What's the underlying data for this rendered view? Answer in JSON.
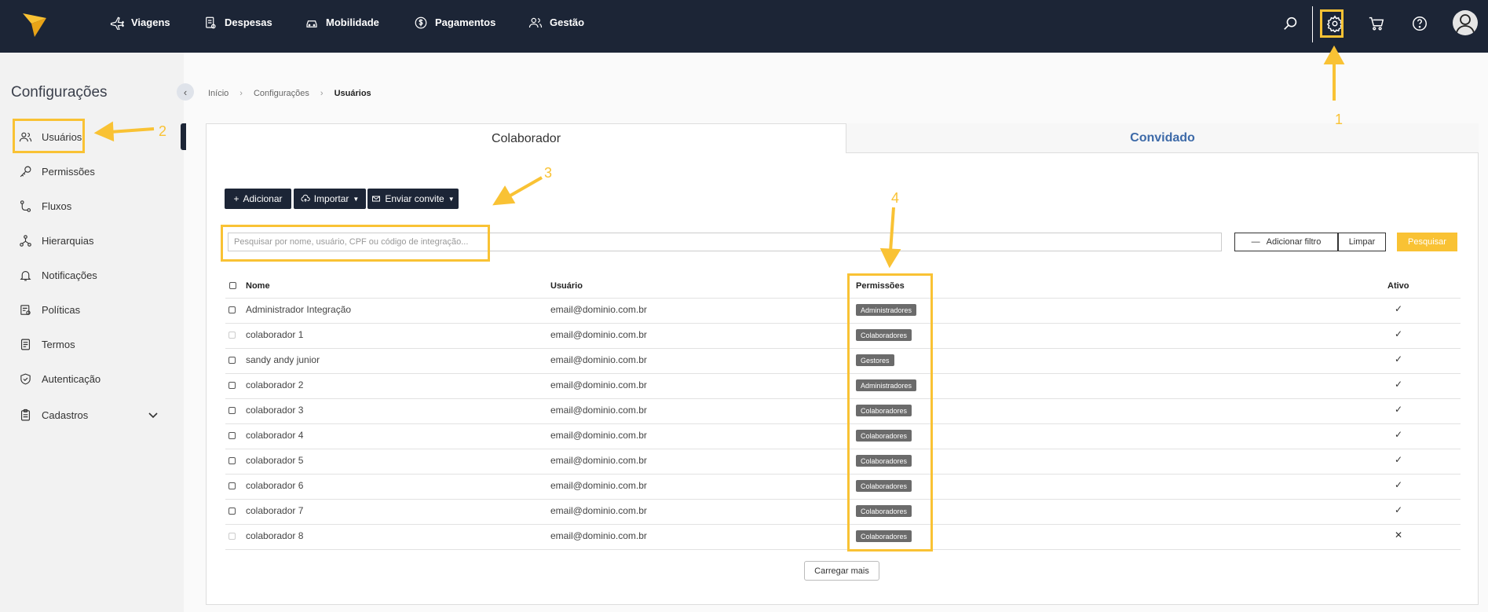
{
  "nav": {
    "items": [
      {
        "label": "Viagens",
        "icon": "plane-icon"
      },
      {
        "label": "Despesas",
        "icon": "receipt-icon"
      },
      {
        "label": "Mobilidade",
        "icon": "car-icon"
      },
      {
        "label": "Pagamentos",
        "icon": "dollar-icon"
      },
      {
        "label": "Gestão",
        "icon": "users-icon"
      }
    ],
    "right_icons": [
      "search-icon",
      "gear-icon",
      "cart-icon",
      "help-icon",
      "avatar-icon"
    ]
  },
  "sidebar": {
    "title": "Configurações",
    "items": [
      {
        "label": "Usuários",
        "icon": "users-icon"
      },
      {
        "label": "Permissões",
        "icon": "key-icon"
      },
      {
        "label": "Fluxos",
        "icon": "flow-icon"
      },
      {
        "label": "Hierarquias",
        "icon": "hierarchy-icon"
      },
      {
        "label": "Notificações",
        "icon": "bell-icon"
      },
      {
        "label": "Políticas",
        "icon": "policy-icon"
      },
      {
        "label": "Termos",
        "icon": "document-icon"
      },
      {
        "label": "Autenticação",
        "icon": "shield-icon"
      },
      {
        "label": "Cadastros",
        "icon": "clipboard-icon"
      }
    ]
  },
  "breadcrumb": [
    "Início",
    "Configurações",
    "Usuários"
  ],
  "tabs": {
    "collaborator": "Colaborador",
    "guest": "Convidado"
  },
  "toolbar": {
    "add": "Adicionar",
    "import": "Importar",
    "invite": "Enviar convite"
  },
  "search": {
    "placeholder": "Pesquisar por nome, usuário, CPF ou código de integração...",
    "add_filter": "Adicionar filtro",
    "clear": "Limpar",
    "search": "Pesquisar"
  },
  "table": {
    "headers": {
      "name": "Nome",
      "user": "Usuário",
      "permissions": "Permissões",
      "active": "Ativo"
    },
    "rows": [
      {
        "name": "Administrador Integração",
        "user": "email@dominio.com.br",
        "permission": "Administradores",
        "active": "✓"
      },
      {
        "name": "colaborador 1",
        "user": "email@dominio.com.br",
        "permission": "Colaboradores",
        "active": "✓"
      },
      {
        "name": "sandy andy junior",
        "user": "email@dominio.com.br",
        "permission": "Gestores",
        "active": "✓"
      },
      {
        "name": "colaborador 2",
        "user": "email@dominio.com.br",
        "permission": "Administradores",
        "active": "✓"
      },
      {
        "name": "colaborador 3",
        "user": "email@dominio.com.br",
        "permission": "Colaboradores",
        "active": "✓"
      },
      {
        "name": "colaborador 4",
        "user": "email@dominio.com.br",
        "permission": "Colaboradores",
        "active": "✓"
      },
      {
        "name": "colaborador 5",
        "user": "email@dominio.com.br",
        "permission": "Colaboradores",
        "active": "✓"
      },
      {
        "name": "colaborador 6",
        "user": "email@dominio.com.br",
        "permission": "Colaboradores",
        "active": "✓"
      },
      {
        "name": "colaborador 7",
        "user": "email@dominio.com.br",
        "permission": "Colaboradores",
        "active": "✓"
      },
      {
        "name": "colaborador 8",
        "user": "email@dominio.com.br",
        "permission": "Colaboradores",
        "active": "✕"
      }
    ],
    "load_more": "Carregar mais"
  },
  "annotations": {
    "n1": "1",
    "n2": "2",
    "n3": "3",
    "n4": "4"
  },
  "colors": {
    "nav_bg": "#1c2536",
    "accent": "#f9c234",
    "guest_tab": "#3d6aa8",
    "badge": "#6b6b6b"
  }
}
